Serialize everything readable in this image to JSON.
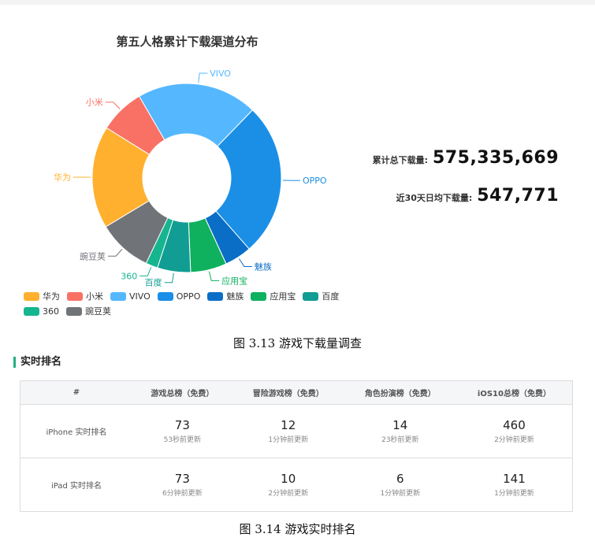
{
  "chart_data": {
    "type": "pie",
    "title": "第五人格累计下载渠道分布",
    "categories": [
      "华为",
      "小米",
      "VIVO",
      "OPPO",
      "魅族",
      "应用宝",
      "百度",
      "360",
      "豌豆荚"
    ],
    "values": [
      17.0,
      7.5,
      20.0,
      25.5,
      4.5,
      6.0,
      5.5,
      2.0,
      9.0
    ],
    "colors": [
      "#ffb02e",
      "#f97165",
      "#55b8ff",
      "#1b8fe6",
      "#0a6ec7",
      "#0fb15e",
      "#119d93",
      "#15b58f",
      "#707378"
    ],
    "legend": "bottom-left"
  },
  "stats": {
    "total_label": "累计总下载量:",
    "total_value": "575,335,669",
    "avg_label": "近30天日均下载量:",
    "avg_value": "547,771"
  },
  "captions": {
    "fig1": "图 3.13    游戏下载量调查",
    "fig2": "图 3.14    游戏实时排名"
  },
  "ranking": {
    "section_title": "实时排名",
    "headers": [
      "#",
      "游戏总榜（免费）",
      "冒险游戏榜（免费）",
      "角色扮演榜（免费）",
      "iOS10总榜（免费）"
    ],
    "rows": [
      {
        "label": "iPhone 实时排名",
        "cells": [
          {
            "rank": "73",
            "updated": "53秒前更新"
          },
          {
            "rank": "12",
            "updated": "1分钟前更新"
          },
          {
            "rank": "14",
            "updated": "23秒前更新"
          },
          {
            "rank": "460",
            "updated": "2分钟前更新"
          }
        ]
      },
      {
        "label": "iPad 实时排名",
        "cells": [
          {
            "rank": "73",
            "updated": "6分钟前更新"
          },
          {
            "rank": "10",
            "updated": "2分钟前更新"
          },
          {
            "rank": "6",
            "updated": "1分钟前更新"
          },
          {
            "rank": "141",
            "updated": "1分钟前更新"
          }
        ]
      }
    ]
  }
}
